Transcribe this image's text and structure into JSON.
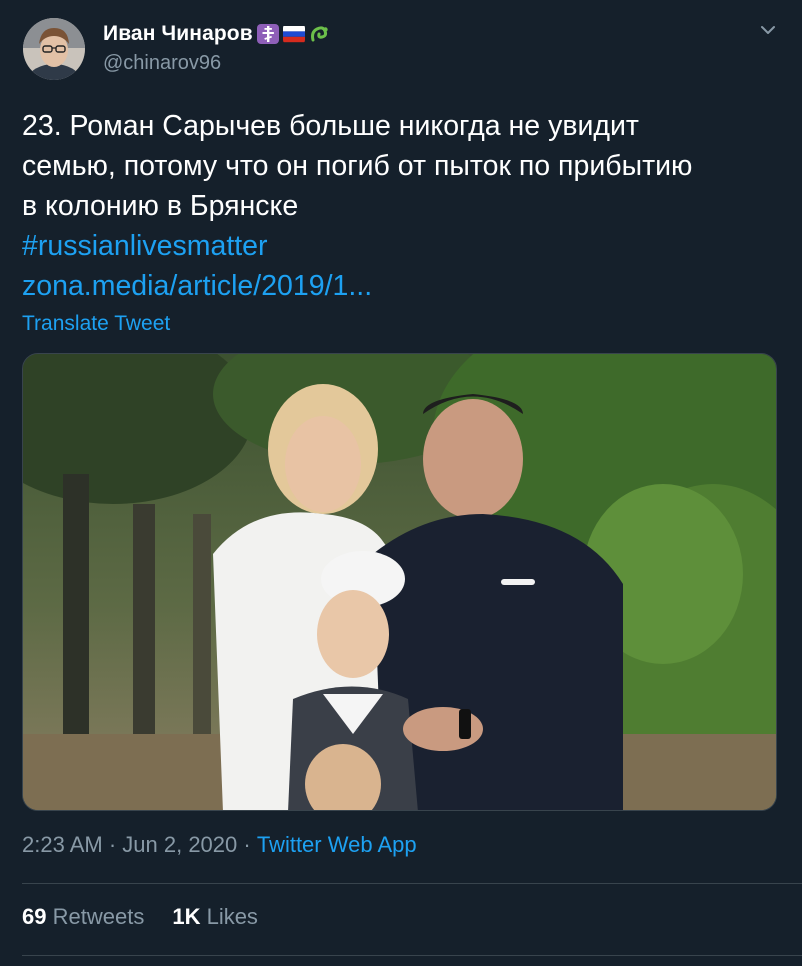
{
  "author": {
    "name": "Иван Чинаров",
    "handle": "@chinarov96",
    "badges": [
      "orthodox-cross-emoji",
      "russian-flag-emoji",
      "green-snake-emoji"
    ]
  },
  "tweet": {
    "text_lines": [
      "23. Роман Сарычев больше никогда не увидит",
      "семью, потому что он погиб от пыток по прибытию",
      "в колонию в Брянске"
    ],
    "hashtag": "#russianlivesmatter",
    "link": "zona.media/article/2019/1...",
    "translate_label": "Translate Tweet"
  },
  "meta": {
    "time": "2:23 AM",
    "separator": " · ",
    "date": "Jun 2, 2020",
    "source": "Twitter Web App"
  },
  "stats": {
    "retweets_count": "69",
    "retweets_label": "Retweets",
    "likes_count": "1K",
    "likes_label": "Likes"
  },
  "colors": {
    "background": "#15202b",
    "link": "#1da1f2",
    "secondary_text": "#8899a6",
    "border": "#38444d"
  }
}
